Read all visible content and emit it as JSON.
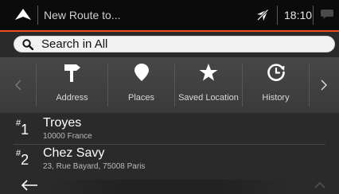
{
  "header": {
    "title": "New Route to...",
    "time": "18:10"
  },
  "search": {
    "label": "Search in All"
  },
  "categories": [
    {
      "label": "Address",
      "icon": "address-signpost-icon"
    },
    {
      "label": "Places",
      "icon": "place-pin-icon"
    },
    {
      "label": "Saved Location",
      "icon": "star-icon"
    },
    {
      "label": "History",
      "icon": "history-clock-icon"
    }
  ],
  "results": [
    {
      "rank": "1",
      "name": "Troyes",
      "address": "10000 France"
    },
    {
      "rank": "2",
      "name": "Chez Savy",
      "address": "23, Rue Bayard, 75008 Paris"
    }
  ],
  "colors": {
    "accent": "#f4501e",
    "topbar": "#0b0b0b",
    "background": "#2a2a2a"
  }
}
